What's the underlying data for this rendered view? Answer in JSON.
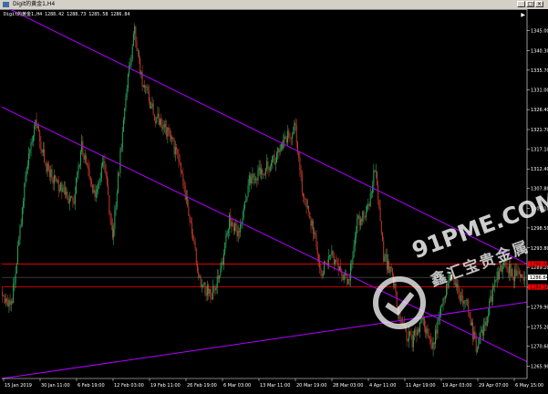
{
  "window": {
    "title": "Digit的黄金1,H4"
  },
  "info_line": "Digit的黄金1,H4  1288.42 1288.73 1285.58 1286.84",
  "watermark": {
    "logo": "91PME.COM",
    "cn": "鑫汇宝贵金属"
  },
  "colors": {
    "background": "#000000",
    "bull": "#26a65b",
    "bear": "#c0392b",
    "channel": "#b000ff",
    "hline": "#ff0000",
    "axis_text": "#ffffff"
  },
  "chart_data": {
    "type": "candlestick",
    "ylim": [
      1263.0,
      1347.5
    ],
    "y_ticks": [
      "1345.00",
      "1340.30",
      "1335.70",
      "1331.00",
      "1326.40",
      "1321.70",
      "1317.10",
      "1312.40",
      "1307.80",
      "1303.10",
      "1298.50",
      "1293.80",
      "1289.20",
      "1284.50",
      "1279.90",
      "1275.20",
      "1270.60",
      "1265.90"
    ],
    "x_labels": [
      "15 Jan 2019",
      "30 Jan 11:00",
      "6 Feb 19:00",
      "12 Feb 03:00",
      "19 Feb 11:00",
      "26 Feb 19:00",
      "6 Mar 03:00",
      "13 Mar 11:00",
      "20 Mar 19:00",
      "28 Mar 03:00",
      "4 Apr 11:00",
      "11 Apr 19:00",
      "19 Apr 03:00",
      "29 Apr 07:00",
      "6 May 15:00"
    ],
    "price_labels": [
      {
        "text": "1290.00",
        "value": 1290.0,
        "color": "#ff0000"
      },
      {
        "text": "1286.84",
        "value": 1286.84,
        "color": "#ffffff"
      },
      {
        "text": "1284.58",
        "value": 1284.58,
        "color": "#ff0000"
      }
    ],
    "current_price": 1286.84,
    "hlines": [
      1290.0,
      1284.58
    ],
    "close_anchors": [
      [
        0,
        1282
      ],
      [
        8,
        1280
      ],
      [
        14,
        1293
      ],
      [
        22,
        1313
      ],
      [
        30,
        1323
      ],
      [
        40,
        1313
      ],
      [
        52,
        1308
      ],
      [
        64,
        1304
      ],
      [
        72,
        1318
      ],
      [
        84,
        1305
      ],
      [
        92,
        1315
      ],
      [
        100,
        1296
      ],
      [
        112,
        1330
      ],
      [
        120,
        1345
      ],
      [
        126,
        1334
      ],
      [
        138,
        1325
      ],
      [
        150,
        1321
      ],
      [
        160,
        1315
      ],
      [
        170,
        1300
      ],
      [
        180,
        1285
      ],
      [
        190,
        1283
      ],
      [
        198,
        1288
      ],
      [
        206,
        1300
      ],
      [
        214,
        1297
      ],
      [
        224,
        1310
      ],
      [
        236,
        1312
      ],
      [
        248,
        1315
      ],
      [
        258,
        1320
      ],
      [
        266,
        1322
      ],
      [
        272,
        1308
      ],
      [
        282,
        1298
      ],
      [
        290,
        1288
      ],
      [
        298,
        1292
      ],
      [
        306,
        1288
      ],
      [
        314,
        1285
      ],
      [
        322,
        1300
      ],
      [
        332,
        1303
      ],
      [
        338,
        1313
      ],
      [
        346,
        1292
      ],
      [
        354,
        1287
      ],
      [
        362,
        1275
      ],
      [
        372,
        1272
      ],
      [
        382,
        1277
      ],
      [
        390,
        1270
      ],
      [
        398,
        1280
      ],
      [
        406,
        1287
      ],
      [
        414,
        1283
      ],
      [
        422,
        1280
      ],
      [
        430,
        1270
      ],
      [
        438,
        1275
      ],
      [
        446,
        1285
      ],
      [
        455,
        1290
      ],
      [
        466,
        1287
      ],
      [
        474,
        1286.84
      ]
    ],
    "channel_upper": [
      [
        0,
        1351
      ],
      [
        100,
        1290
      ]
    ],
    "channel_lower": [
      [
        0,
        1327
      ],
      [
        100,
        1267
      ]
    ],
    "support_line": [
      [
        0,
        1263
      ],
      [
        100,
        1281
      ]
    ]
  }
}
